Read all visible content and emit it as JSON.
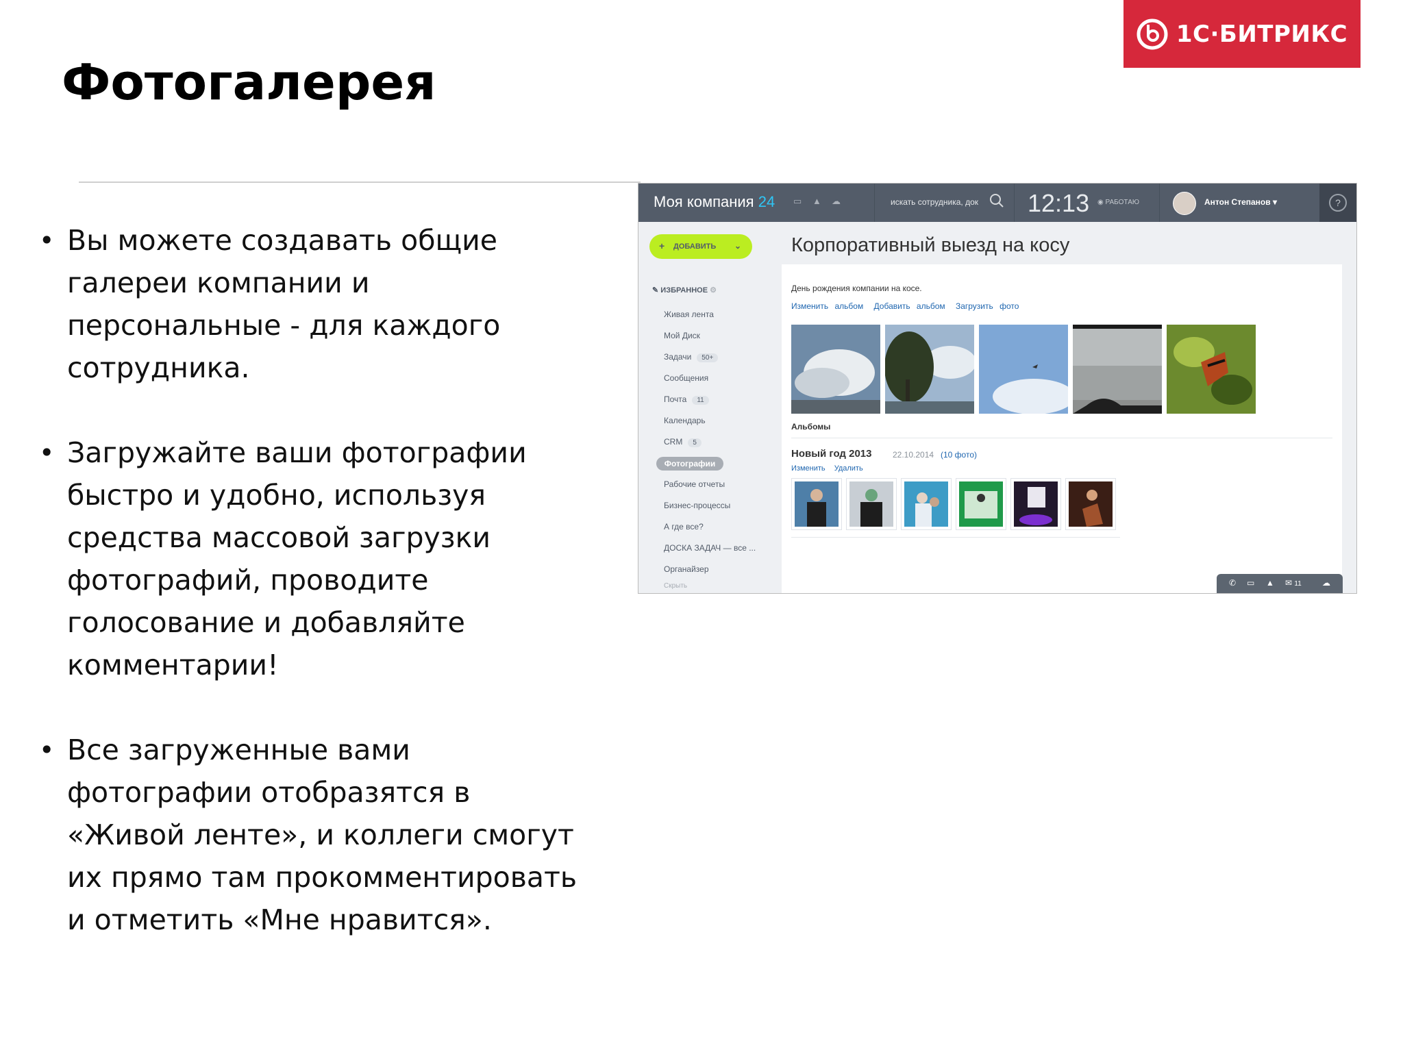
{
  "slide": {
    "title": "Фотогалерея",
    "logo_text": "1С·БИТРИКС",
    "bullets": [
      "Вы можете создавать общие галереи компании и персональные - для каждого сотрудника.",
      "Загружайте ваши фотографии быстро и удобно, используя средства массовой загрузки фотографий, проводите голосование и добавляйте комментарии!",
      "Все загруженные вами фотографии отобразятся в «Живой ленте», и коллеги смогут их прямо там прокомментировать и отметить «Мне нравится»."
    ]
  },
  "app": {
    "company_name": "Моя компания",
    "company_num": "24",
    "search_placeholder": "искать сотрудника, док",
    "time": "12:13",
    "status": "РАБОТАЮ",
    "user_name": "Антон Степанов",
    "help": "?"
  },
  "sidebar": {
    "add_label": "ДОБАВИТЬ",
    "favorites_label": "ИЗБРАННОЕ",
    "items": [
      {
        "label": "Живая лента",
        "badge": ""
      },
      {
        "label": "Мой Диск",
        "badge": ""
      },
      {
        "label": "Задачи",
        "badge": "50+"
      },
      {
        "label": "Сообщения",
        "badge": ""
      },
      {
        "label": "Почта",
        "badge": "11"
      },
      {
        "label": "Календарь",
        "badge": ""
      },
      {
        "label": "CRM",
        "badge": "5"
      },
      {
        "label": "Фотографии",
        "badge": ""
      },
      {
        "label": "Рабочие отчеты",
        "badge": ""
      },
      {
        "label": "Бизнес-процессы",
        "badge": ""
      },
      {
        "label": "А где все?",
        "badge": ""
      },
      {
        "label": "ДОСКА ЗАДАЧ — все ...",
        "badge": ""
      },
      {
        "label": "Органайзер",
        "badge": ""
      },
      {
        "label": "Скрыть",
        "badge": ""
      }
    ],
    "active_item": "Фотографии"
  },
  "gallery": {
    "page_title": "Корпоративный выезд на косу",
    "album_desc": "День рождения компании на косе.",
    "links": [
      "Изменить альбом",
      "Добавить альбом",
      "Загрузить фото"
    ],
    "albums_label": "Альбомы",
    "album": {
      "title": "Новый год 2013",
      "date": "22.10.2014",
      "count": "(10 фото)",
      "links": [
        "Изменить",
        "Удалить"
      ]
    }
  },
  "bottom_bar": {
    "mail_count": "11"
  },
  "colors": {
    "brand_red": "#d6283b",
    "topbar": "#535c69",
    "accent_green": "#bbed21",
    "link_blue": "#2067b0"
  }
}
